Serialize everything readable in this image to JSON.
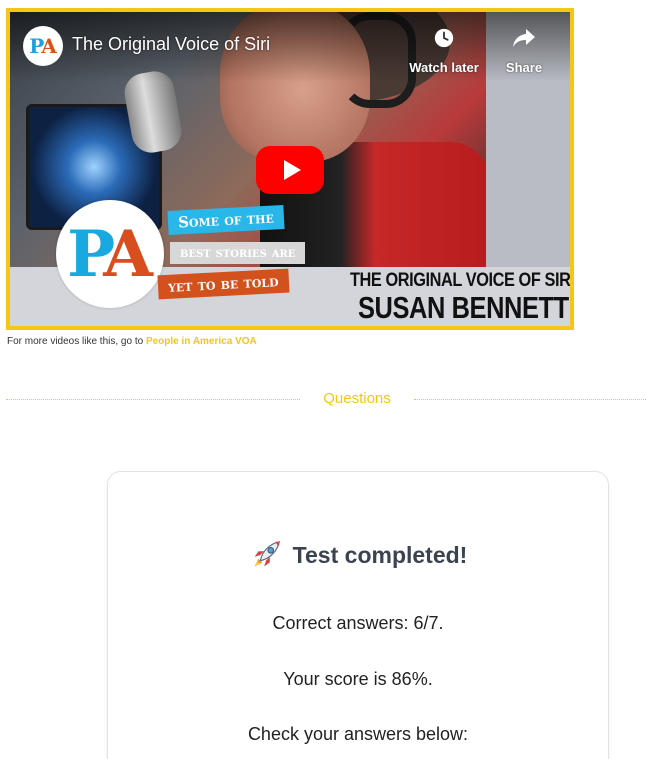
{
  "video": {
    "title": "The Original Voice of Siri",
    "channel_avatar_p": "P",
    "channel_avatar_a": "A",
    "watch_later_label": "Watch later",
    "share_label": "Share",
    "logo_p": "P",
    "logo_a": "A",
    "tag_line_1": "Some of the",
    "tag_line_2": "best stories are",
    "tag_line_3": "yet to be told",
    "headline_line_1": "THE ORIGINAL VOICE OF SIRI",
    "headline_line_2": "SUSAN BENNETT",
    "colors": {
      "border": "#f5c518",
      "play_button": "#ff0000"
    }
  },
  "caption": {
    "prefix": "For more videos like this, go to ",
    "link_text": "People in America VOA"
  },
  "section": {
    "label": "Questions"
  },
  "result": {
    "icon": "rocket-icon",
    "title": "Test completed!",
    "correct_answers": "Correct answers: 6/7.",
    "score": "Your score is 86%.",
    "check": "Check your answers below:"
  }
}
